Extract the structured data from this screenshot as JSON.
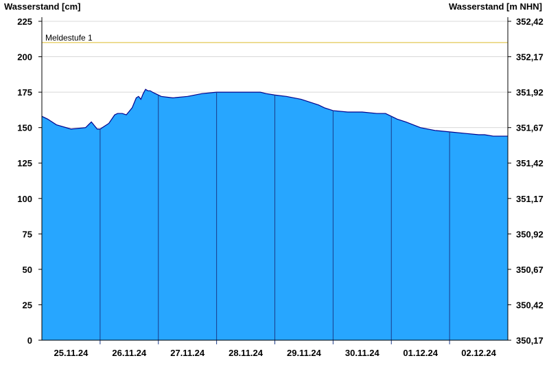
{
  "chart_data": {
    "type": "area",
    "ylabel_left": "Wasserstand [cm]",
    "ylabel_right": "Wasserstand [m NHN]",
    "ylim": [
      0,
      225
    ],
    "yticks_left": [
      "0",
      "25",
      "50",
      "75",
      "100",
      "125",
      "150",
      "175",
      "200",
      "225"
    ],
    "yticks_left_values": [
      0,
      25,
      50,
      75,
      100,
      125,
      150,
      175,
      200,
      225
    ],
    "yticks_right": [
      "350,17",
      "350,42",
      "350,67",
      "350,92",
      "351,17",
      "351,42",
      "351,67",
      "351,92",
      "352,17",
      "352,42"
    ],
    "x_categories": [
      "25.11.24",
      "26.11.24",
      "27.11.24",
      "28.11.24",
      "29.11.24",
      "30.11.24",
      "01.12.24",
      "02.12.24"
    ],
    "x_range_days": [
      0,
      8
    ],
    "grid": true,
    "threshold": {
      "label": "Meldestufe 1",
      "value": 210,
      "color": "#e8d070"
    },
    "colors": {
      "fill": "#27a6ff",
      "line": "#00008b",
      "grid": "#d8d8d8",
      "divider": "#1a3a8a"
    },
    "series": [
      {
        "x": [
          0,
          0.1,
          0.25,
          0.5,
          0.75,
          0.85,
          0.95,
          1.0,
          1.15,
          1.25,
          1.3,
          1.38,
          1.45,
          1.55,
          1.62,
          1.66,
          1.7,
          1.74,
          1.78,
          1.82,
          1.86,
          1.9,
          1.95,
          2.05,
          2.25,
          2.5,
          2.75,
          3.0,
          3.25,
          3.5,
          3.75,
          3.85,
          4.0,
          4.2,
          4.45,
          4.6,
          4.75,
          4.85,
          5.0,
          5.25,
          5.5,
          5.75,
          5.9,
          6.0,
          6.1,
          6.25,
          6.5,
          6.75,
          7.0,
          7.25,
          7.5,
          7.6,
          7.75,
          8.0
        ],
        "y": [
          158,
          156,
          152,
          149,
          150,
          154,
          149,
          149,
          153,
          159,
          160,
          160,
          159,
          164,
          171,
          172,
          170,
          174,
          177,
          176,
          176,
          175,
          174,
          172,
          171,
          172,
          174,
          175,
          175,
          175,
          175,
          174,
          173,
          172,
          170,
          168,
          166,
          164,
          162,
          161,
          161,
          160,
          160,
          158,
          156,
          154,
          150,
          148,
          147,
          146,
          145,
          145,
          144,
          144
        ]
      }
    ]
  }
}
